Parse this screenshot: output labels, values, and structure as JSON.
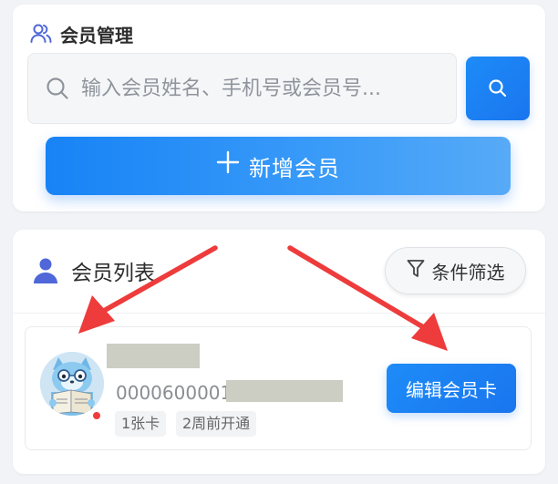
{
  "member_management": {
    "title": "会员管理",
    "title_icon": "users-icon",
    "search": {
      "placeholder": "输入会员姓名、手机号或会员号...",
      "value": "",
      "field_icon": "search-icon",
      "button_icon": "search-icon"
    },
    "add_button": {
      "icon": "plus-icon",
      "label": "新增会员"
    }
  },
  "member_list": {
    "title": "会员列表",
    "title_icon": "user-icon",
    "filter_button": {
      "icon": "filter-icon",
      "label": "条件筛选"
    },
    "members": [
      {
        "avatar": "cartoon-avatar",
        "status_color": "#ef3b3b",
        "name": "",
        "member_no": "0000600001",
        "tags": [
          "1张卡",
          "2周前开通"
        ],
        "edit_label": "编辑会员卡"
      }
    ]
  },
  "annotations": {
    "arrow_color": "#ee3b3b",
    "arrows": [
      "arrow-to-avatar",
      "arrow-to-edit-button"
    ]
  },
  "colors": {
    "primary": "#1a7ff5",
    "background": "#f1f3f7",
    "card": "#ffffff",
    "redaction": "#cccdc3"
  }
}
